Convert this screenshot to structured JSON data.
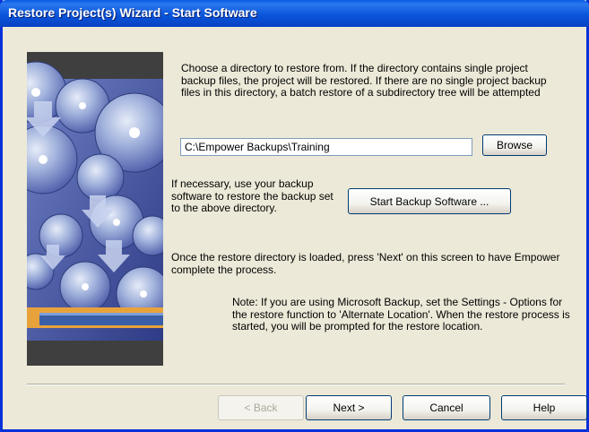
{
  "window": {
    "title": "Restore Project(s) Wizard - Start Software"
  },
  "intro_text": "Choose a directory to restore from.  If the directory contains single project backup files, the project will be restored.  If there are no single project backup files in this directory, a batch restore of a subdirectory tree will be attempted",
  "directory": {
    "value": "C:\\Empower Backups\\Training",
    "browse_label": "Browse"
  },
  "backup_hint": "If necessary, use your backup software to restore the backup set to the above directory.",
  "start_backup_label": "Start Backup Software ...",
  "once_text": "Once the restore directory is loaded, press 'Next' on this screen to have Empower complete the process.",
  "note_text": "Note: If you are using Microsoft Backup, set the Settings - Options for the restore function to 'Alternate Location'. When the restore process is started, you will be prompted for the restore location.",
  "footer": {
    "back_label": "< Back",
    "next_label": "Next >",
    "cancel_label": "Cancel",
    "help_label": "Help"
  },
  "colors": {
    "titlebar": "#0a55db",
    "dialog_bg": "#ece9d8",
    "accent_orange": "#e8a23c"
  }
}
